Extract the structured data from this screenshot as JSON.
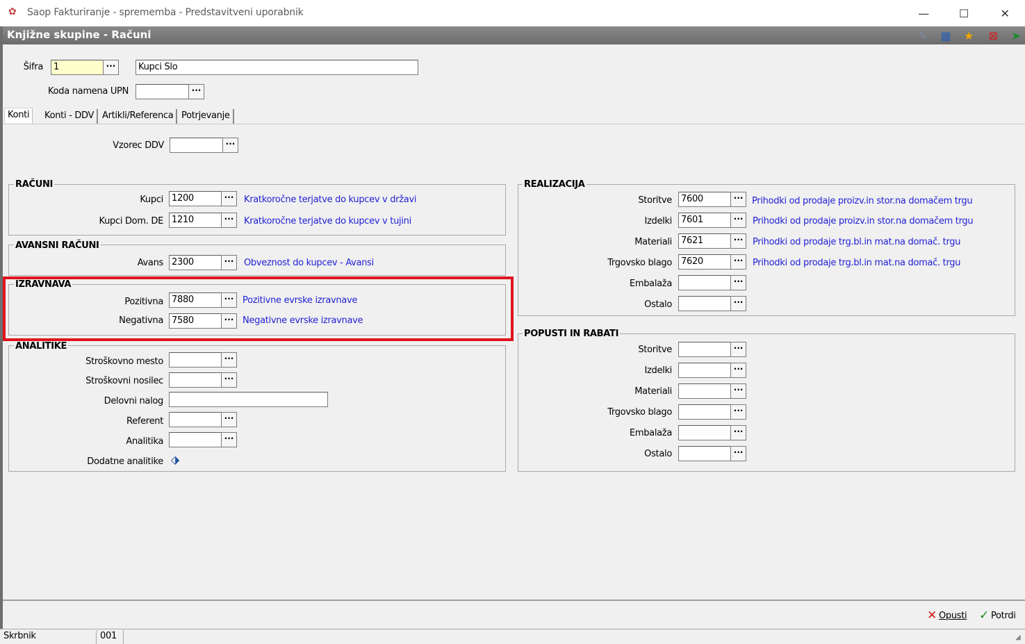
{
  "window": {
    "app_title": "Saop Fakturiranje - sprememba - Predstavitveni uporabnik",
    "minimize": "—",
    "maximize": "☐",
    "close": "✕"
  },
  "form": {
    "title": "Knjižne skupine - Računi"
  },
  "toolbar_icons": [
    "edit-icon",
    "table-icon",
    "star-icon",
    "delete-icon",
    "export-icon"
  ],
  "header": {
    "sifra_label": "Šifra",
    "sifra_value": "1",
    "naziv_value": "Kupci Slo",
    "koda_label": "Koda namena UPN",
    "koda_value": ""
  },
  "tabs": [
    "Konti",
    "Konti - DDV",
    "Artikli/Referenca",
    "Potrjevanje"
  ],
  "vzorec": {
    "label": "Vzorec DDV",
    "value": ""
  },
  "dots": "···",
  "racuni": {
    "title": "RAČUNI",
    "rows": [
      {
        "label": "Kupci",
        "value": "1200",
        "desc": "Kratkoročne terjatve do kupcev v državi"
      },
      {
        "label": "Kupci Dom. DE",
        "value": "1210",
        "desc": "Kratkoročne terjatve do kupcev v tujini"
      }
    ]
  },
  "avansni": {
    "title": "AVANSNI RAČUNI",
    "rows": [
      {
        "label": "Avans",
        "value": "2300",
        "desc": "Obveznost do kupcev - Avansi"
      }
    ]
  },
  "izravnava": {
    "title": "IZRAVNAVA",
    "rows": [
      {
        "label": "Pozitivna",
        "value": "7880",
        "desc": "Pozitivne evrske izravnave"
      },
      {
        "label": "Negativna",
        "value": "7580",
        "desc": "Negativne evrske izravnave"
      }
    ]
  },
  "analitike": {
    "title": "ANALITIKE",
    "rows": [
      {
        "label": "Stroškovno mesto",
        "value": ""
      },
      {
        "label": "Stroškovni nosilec",
        "value": ""
      },
      {
        "label": "Delovni nalog",
        "value": ""
      },
      {
        "label": "Referent",
        "value": ""
      },
      {
        "label": "Analitika",
        "value": ""
      },
      {
        "label": "Dodatne analitike"
      }
    ]
  },
  "realizacija": {
    "title": "REALIZACIJA",
    "rows": [
      {
        "label": "Storitve",
        "value": "7600",
        "desc": "Prihodki od prodaje proizv.in stor.na domačem trgu"
      },
      {
        "label": "Izdelki",
        "value": "7601",
        "desc": "Prihodki od prodaje proizv.in stor.na domačem trgu"
      },
      {
        "label": "Materiali",
        "value": "7621",
        "desc": "Prihodki od prodaje trg.bl.in mat.na domač. trgu"
      },
      {
        "label": "Trgovsko blago",
        "value": "7620",
        "desc": "Prihodki od prodaje trg.bl.in mat.na domač. trgu"
      },
      {
        "label": "Embalaža",
        "value": "",
        "desc": ""
      },
      {
        "label": "Ostalo",
        "value": "",
        "desc": ""
      }
    ]
  },
  "popusti": {
    "title": "POPUSTI IN RABATI",
    "rows": [
      {
        "label": "Storitve",
        "value": ""
      },
      {
        "label": "Izdelki",
        "value": ""
      },
      {
        "label": "Materiali",
        "value": ""
      },
      {
        "label": "Trgovsko blago",
        "value": ""
      },
      {
        "label": "Embalaža",
        "value": ""
      },
      {
        "label": "Ostalo",
        "value": ""
      }
    ]
  },
  "footer": {
    "cancel_label": "Opusti",
    "confirm_label": "Potrdi"
  },
  "status": {
    "user": "Skrbnik",
    "code": "001",
    "extra": ""
  },
  "colors": {
    "link": "#1f1fd6",
    "highlight": "#e0141e",
    "required": "#ffffcc"
  }
}
